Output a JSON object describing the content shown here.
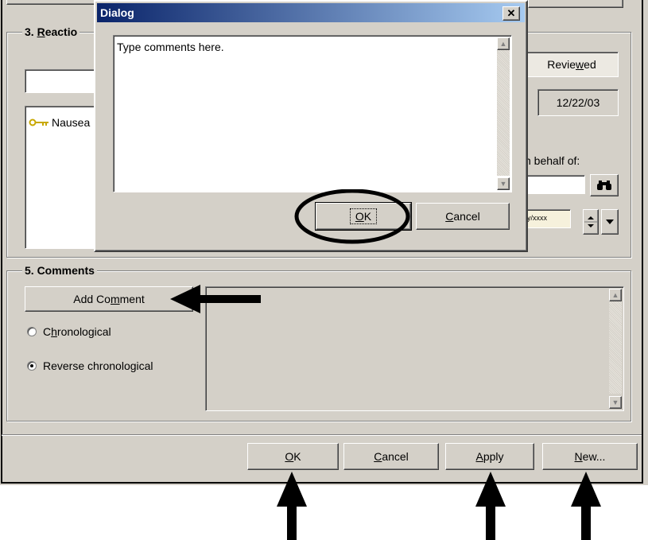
{
  "sections": {
    "reactions_title": "3. Reactio",
    "reactions_accel": "R",
    "comments_title": "5. Comments"
  },
  "reaction_item": "Nausea",
  "right_panel": {
    "reviewed_label": "Reviewed",
    "date": "12/22/03",
    "on_behalf_label": "n behalf of:",
    "date_field_placeholder": "y/xxxx"
  },
  "comments": {
    "add_button": "Add Comment",
    "radio_chronological": "Chronological",
    "radio_reverse": "Reverse chronological",
    "selected": "Reverse chronological"
  },
  "bottom_buttons": {
    "ok": "OK",
    "cancel": "Cancel",
    "apply": "Apply",
    "new": "New..."
  },
  "dialog": {
    "title": "Dialog",
    "text": "Type comments here.",
    "ok": "OK",
    "cancel": "Cancel"
  },
  "icons": [
    "key-icon",
    "binoculars-icon",
    "spin-arrows-icon",
    "dropdown-arrow-icon",
    "close-icon",
    "scroll-up-icon",
    "scroll-down-icon"
  ]
}
